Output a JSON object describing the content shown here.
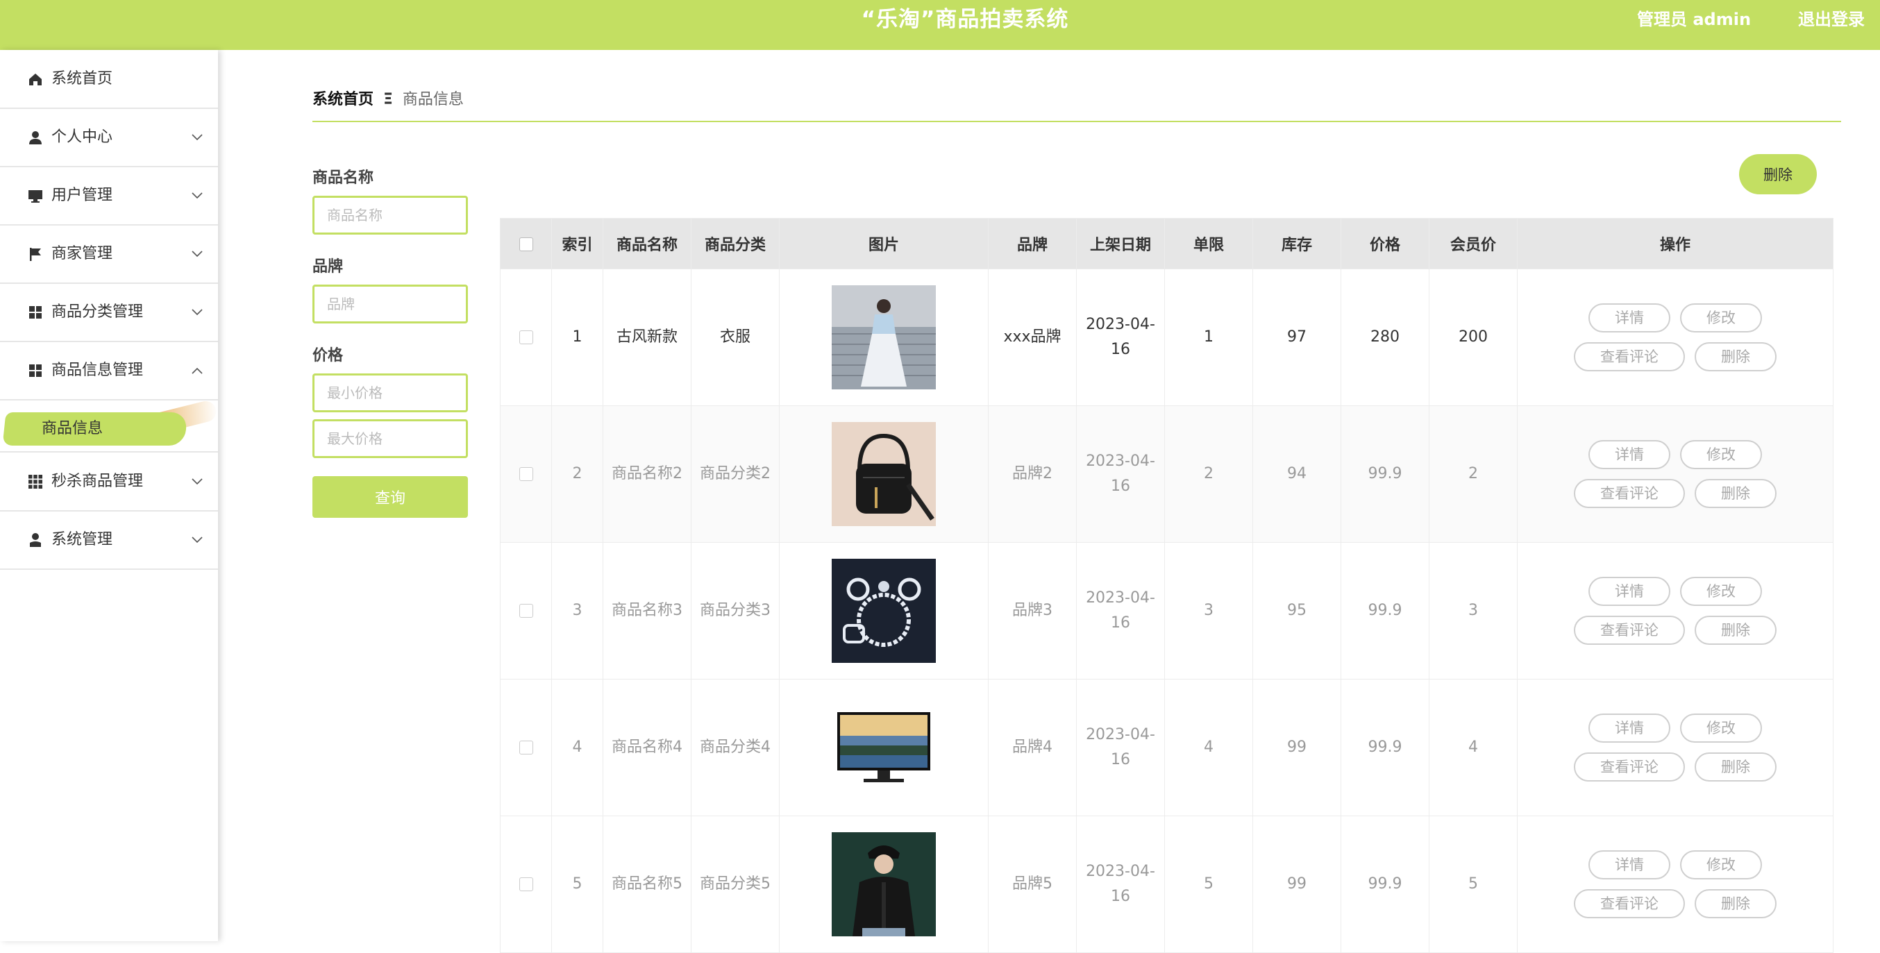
{
  "header": {
    "title": "“乐淘”商品拍卖系统",
    "admin": "管理员 admin",
    "logout": "退出登录"
  },
  "sidebar": {
    "items": [
      {
        "label": "系统首页",
        "icon": "home-icon"
      },
      {
        "label": "个人中心",
        "icon": "user-icon"
      },
      {
        "label": "用户管理",
        "icon": "monitor-icon"
      },
      {
        "label": "商家管理",
        "icon": "flag-icon"
      },
      {
        "label": "商品分类管理",
        "icon": "grid-icon"
      },
      {
        "label": "商品信息管理",
        "icon": "grid-icon"
      },
      {
        "label": "秒杀商品管理",
        "icon": "apps-icon"
      },
      {
        "label": "系统管理",
        "icon": "user-admin-icon"
      }
    ],
    "active_sub": "商品信息"
  },
  "breadcrumb": {
    "home": "系统首页",
    "separator": "Ξ",
    "current": "商品信息"
  },
  "search": {
    "name_label": "商品名称",
    "name_placeholder": "商品名称",
    "brand_label": "品牌",
    "brand_placeholder": "品牌",
    "price_label": "价格",
    "min_placeholder": "最小价格",
    "max_placeholder": "最大价格",
    "query_button": "查询"
  },
  "toolbar": {
    "delete_button": "删除"
  },
  "table": {
    "headers": [
      "索引",
      "商品名称",
      "商品分类",
      "图片",
      "品牌",
      "上架日期",
      "单限",
      "库存",
      "价格",
      "会员价",
      "操作"
    ],
    "actions": {
      "detail": "详情",
      "edit": "修改",
      "comments": "查看评论",
      "delete": "删除"
    },
    "rows": [
      {
        "index": "1",
        "name": "古风新款",
        "category": "衣服",
        "image": "woman-in-hanfu-dress",
        "brand": "xxx品牌",
        "date": "2023-04-16",
        "limit": "1",
        "stock": "97",
        "price": "280",
        "member_price": "200"
      },
      {
        "index": "2",
        "name": "商品名称2",
        "category": "商品分类2",
        "image": "black-handbag",
        "brand": "品牌2",
        "date": "2023-04-16",
        "limit": "2",
        "stock": "94",
        "price": "99.9",
        "member_price": "2"
      },
      {
        "index": "3",
        "name": "商品名称3",
        "category": "商品分类3",
        "image": "diamond-jewelry-set",
        "brand": "品牌3",
        "date": "2023-04-16",
        "limit": "3",
        "stock": "95",
        "price": "99.9",
        "member_price": "3"
      },
      {
        "index": "4",
        "name": "商品名称4",
        "category": "商品分类4",
        "image": "flat-screen-tv",
        "brand": "品牌4",
        "date": "2023-04-16",
        "limit": "4",
        "stock": "99",
        "price": "99.9",
        "member_price": "4"
      },
      {
        "index": "5",
        "name": "商品名称5",
        "category": "商品分类5",
        "image": "person-in-black-jacket",
        "brand": "品牌5",
        "date": "2023-04-16",
        "limit": "5",
        "stock": "99",
        "price": "99.9",
        "member_price": "5"
      }
    ]
  },
  "colors": {
    "accent": "#c3df62",
    "header_bg": "#e6e6e6"
  }
}
